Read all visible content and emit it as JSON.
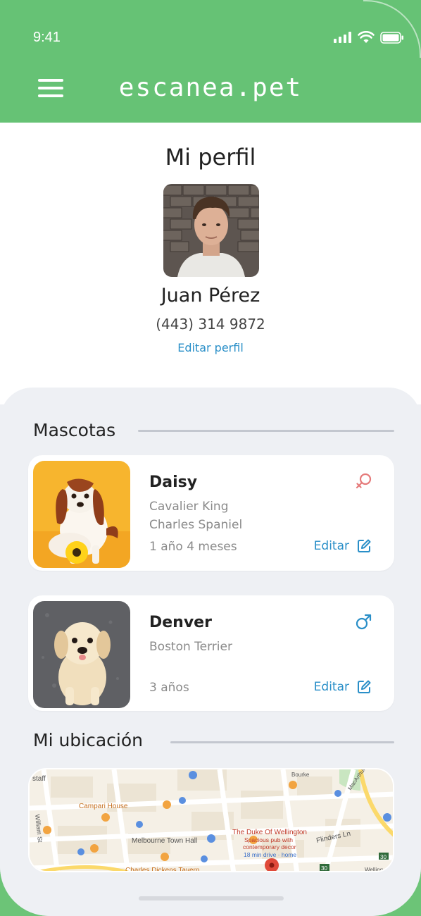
{
  "status_bar": {
    "time": "9:41"
  },
  "header": {
    "brand": "escanea.pet"
  },
  "profile": {
    "title": "Mi perfil",
    "name": "Juan Pérez",
    "phone": "(443) 314 9872",
    "edit_label": "Editar perfil"
  },
  "pets_section": {
    "title": "Mascotas",
    "edit_label": "Editar",
    "pets": [
      {
        "name": "Daisy",
        "breed_line1": "Cavalier King",
        "breed_line2": "Charles Spaniel",
        "age": "1 año 4 meses",
        "gender_icon": "female-icon",
        "gender_color": "#e57a7a"
      },
      {
        "name": "Denver",
        "breed_line1": "Boston Terrier",
        "breed_line2": "",
        "age": "3 años",
        "gender_icon": "male-icon",
        "gender_color": "#2a8fc8"
      }
    ]
  },
  "location_section": {
    "title": "Mi ubicación",
    "map_labels": {
      "campari": "Campari House",
      "melbourne": "Melbourne Town Hall",
      "duke": "The Duke Of Wellington",
      "duke_desc1": "Spacious pub with",
      "duke_desc2": "contemporary decor",
      "duke_desc3": "18 min drive · home",
      "dickens": "Charles Dickens Tavern",
      "flinders": "Flinders Ln",
      "william": "William St",
      "bourke": "Bourke",
      "macarthur": "MacArthur",
      "staff": "staff",
      "welling": "Welling",
      "route30a": "30",
      "route30b": "30"
    }
  },
  "colors": {
    "primary_green": "#66c275",
    "link_blue": "#2a8fc8"
  }
}
